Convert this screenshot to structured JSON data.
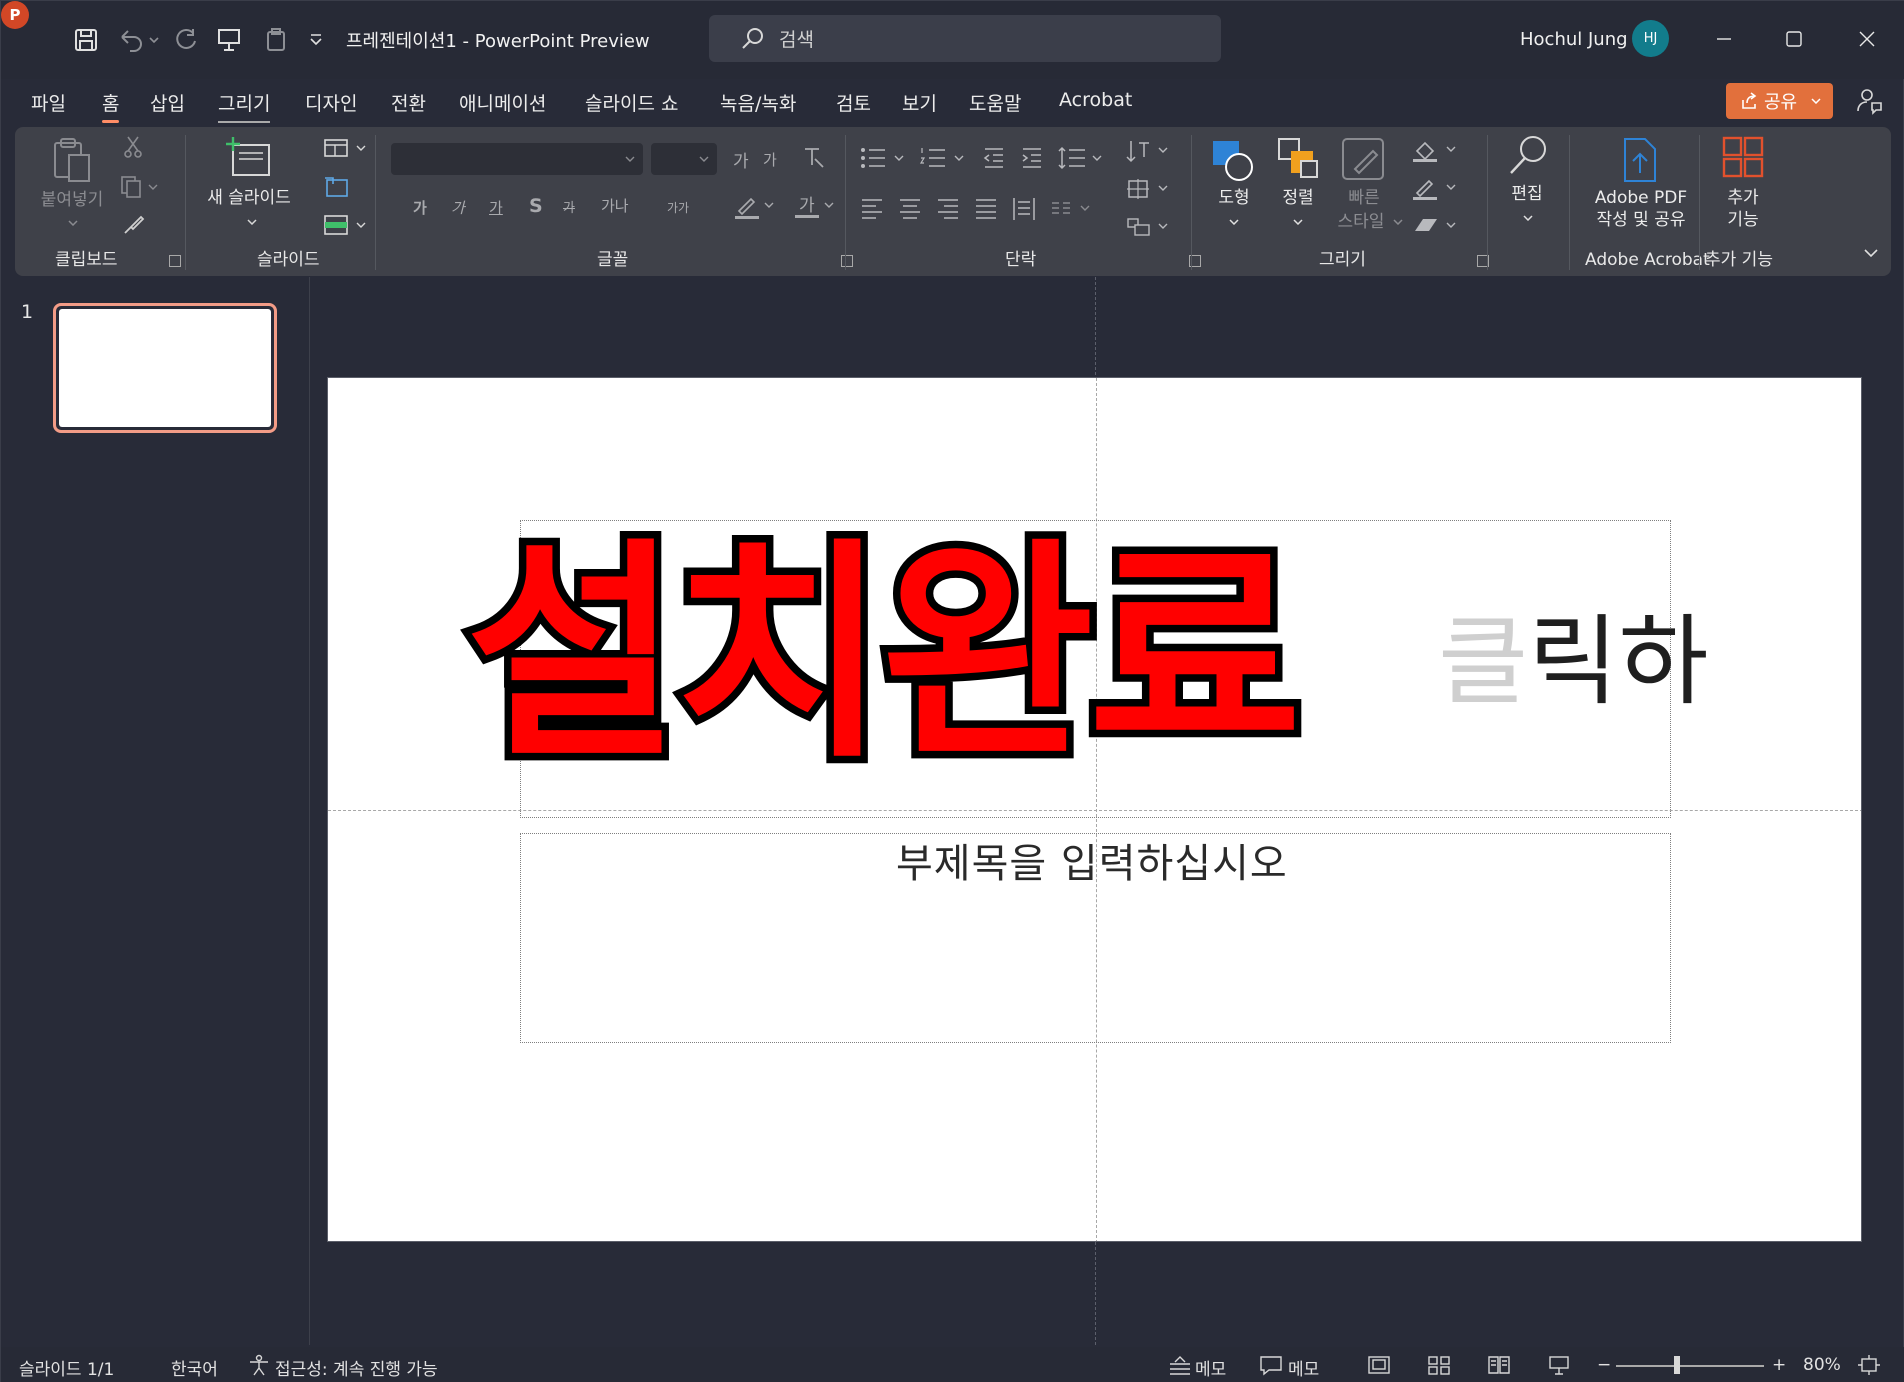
{
  "titlebar": {
    "doc_title": "프레젠테이션1  -  PowerPoint Preview",
    "search_placeholder": "검색",
    "user_name": "Hochul Jung",
    "avatar_initials": "HJ"
  },
  "menu": {
    "items": [
      "파일",
      "홈",
      "삽입",
      "그리기",
      "디자인",
      "전환",
      "애니메이션",
      "슬라이드 쇼",
      "녹음/녹화",
      "검토",
      "보기",
      "도움말",
      "Acrobat"
    ],
    "active": "홈",
    "share_label": "공유"
  },
  "ribbon": {
    "clipboard": {
      "paste_label": "붙여넣기",
      "group_label": "클립보드"
    },
    "slides": {
      "new_slide_label": "새 슬라이드",
      "group_label": "슬라이드"
    },
    "font": {
      "group_label": "글꼴",
      "glyphs": [
        "가",
        "가",
        "가",
        "S",
        "가",
        "가나",
        "가가",
        "가"
      ],
      "grow": "가",
      "shrink": "가"
    },
    "paragraph": {
      "group_label": "단락"
    },
    "drawing": {
      "shapes_label": "도형",
      "arrange_label": "정렬",
      "quick_styles_label_1": "빠른",
      "quick_styles_label_2": "스타일",
      "group_label": "그리기"
    },
    "editing": {
      "label": "편집"
    },
    "acrobat": {
      "line1": "Adobe PDF",
      "line2": "작성 및 공유",
      "group_label": "Adobe Acrobat"
    },
    "addins": {
      "line1": "추가",
      "line2": "기능",
      "group_label": "추가 기능"
    }
  },
  "thumbnails": {
    "slide_number": "1"
  },
  "slide": {
    "title_prompt_ghost": "클",
    "title_prompt_visible": "릭하",
    "subtitle_prompt": "부제목을 입력하십시오",
    "overlay_text": "설치완료"
  },
  "statusbar": {
    "slide_info": "슬라이드 1/1",
    "language": "한국어",
    "accessibility": "접근성: 계속 진행 가능",
    "notes_label": "메모",
    "comments_label": "메모",
    "zoom": "80%"
  },
  "colors": {
    "accent": "#e2703c",
    "overlay_fill": "#ff0000",
    "overlay_stroke": "#000000",
    "thumb_border": "#f39c87"
  },
  "zoom_level_percent": 80
}
